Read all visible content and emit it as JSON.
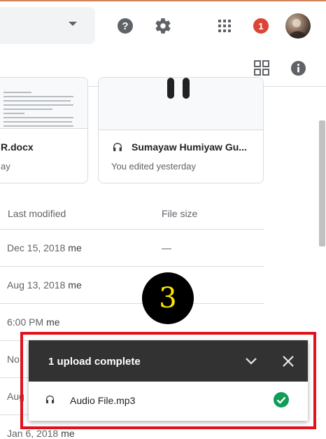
{
  "header": {
    "notification_count": "1"
  },
  "cards": [
    {
      "title": "R.docx",
      "subtitle": "ay"
    },
    {
      "title": "Sumayaw Humiyaw Gu...",
      "subtitle": "You edited yesterday"
    }
  ],
  "table": {
    "columns": [
      "Last modified",
      "File size"
    ],
    "rows": [
      {
        "modified": "Dec 15, 2018",
        "owner": "me",
        "size": "—"
      },
      {
        "modified": "Aug 13, 2018",
        "owner": "me",
        "size": ""
      },
      {
        "modified": "6:00 PM",
        "owner": "me",
        "size": ""
      },
      {
        "modified": "No",
        "owner": "",
        "size": ""
      },
      {
        "modified": "Aug",
        "owner": "",
        "size": ""
      },
      {
        "modified": "Jan 6, 2018",
        "owner": "me",
        "size": ""
      }
    ]
  },
  "annotation": {
    "step": "3"
  },
  "upload": {
    "title": "1 upload complete",
    "file_name": "Audio File.mp3"
  },
  "colors": {
    "notification": "#db4437",
    "highlight_box": "#e0121d",
    "success": "#0f9d58"
  }
}
